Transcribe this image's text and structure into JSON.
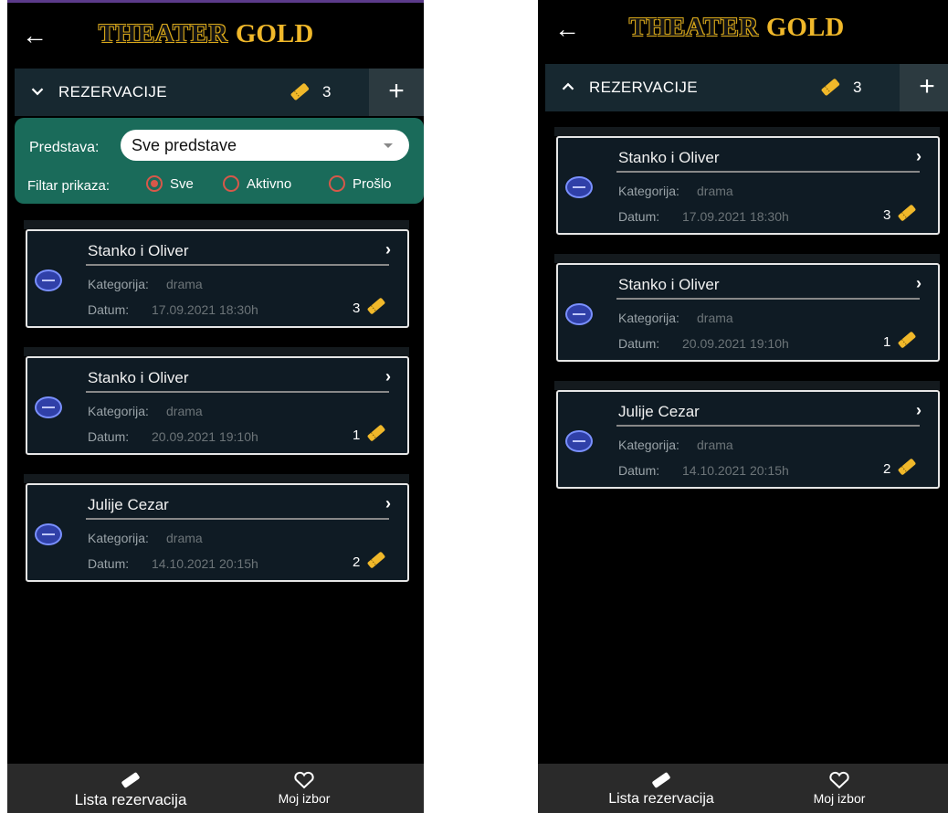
{
  "app": {
    "logo_left": "THEATER",
    "logo_right": "GOLD",
    "reservations_title": "REZERVACIJE",
    "reservations_count": "3"
  },
  "filter": {
    "show_label": "Predstava:",
    "show_value": "Sve predstave",
    "filter_label": "Filtar prikaza:",
    "options": [
      "Sve",
      "Aktivno",
      "Prošlo"
    ],
    "selected": "Sve"
  },
  "reservations": [
    {
      "title": "Stanko i Oliver",
      "category_label": "Kategorija:",
      "category": "drama",
      "date_label": "Datum:",
      "date": "17.09.2021 18:30h",
      "tickets": "3"
    },
    {
      "title": "Stanko i Oliver",
      "category_label": "Kategorija:",
      "category": "drama",
      "date_label": "Datum:",
      "date": "20.09.2021 19:10h",
      "tickets": "1"
    },
    {
      "title": "Julije Cezar",
      "category_label": "Kategorija:",
      "category": "drama",
      "date_label": "Datum:",
      "date": "14.10.2021 20:15h",
      "tickets": "2"
    }
  ],
  "nav": {
    "reservations_list": "Lista rezervacija",
    "my_choice": "Moj izbor"
  },
  "colors": {
    "accent_gold": "#f0b82a",
    "filter_bg": "#1a6b5a",
    "radio": "#d7584a",
    "header_bar": "#172830"
  },
  "icons": {
    "back": "arrow-left-icon",
    "ticket": "ticket-icon",
    "plus": "plus-icon",
    "heart": "heart-icon"
  }
}
